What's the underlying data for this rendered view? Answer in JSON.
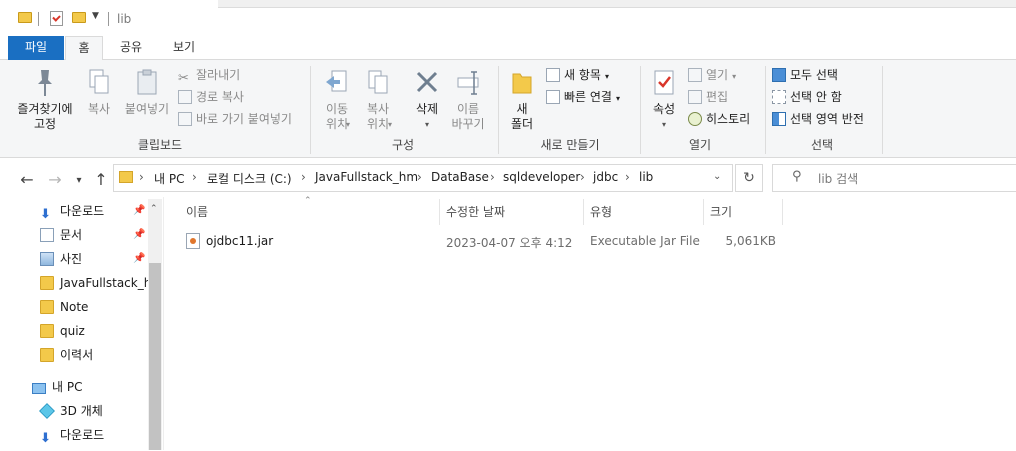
{
  "window": {
    "title": "lib"
  },
  "ribbon_tabs": [
    {
      "label": "파일"
    },
    {
      "label": "홈"
    },
    {
      "label": "공유"
    },
    {
      "label": "보기"
    }
  ],
  "clipboard": {
    "pin_quick": "즐겨찾기에\n고정",
    "copy": "복사",
    "paste": "붙여넣기",
    "cut": "잘라내기",
    "copy_path": "경로 복사",
    "paste_shortcut": "바로 가기 붙여넣기",
    "group": "클립보드"
  },
  "organize": {
    "move_to": "이동\n위치",
    "copy_to": "복사\n위치",
    "delete": "삭제",
    "rename": "이름\n바꾸기",
    "group": "구성"
  },
  "new": {
    "new_folder": "새\n폴더",
    "new_item": "새 항목",
    "easy_access": "빠른 연결",
    "group": "새로 만들기"
  },
  "open": {
    "properties": "속성",
    "open": "열기",
    "edit": "편집",
    "history": "히스토리",
    "group": "열기"
  },
  "select": {
    "select_all": "모두 선택",
    "select_none": "선택 안 함",
    "invert": "선택 영역 반전",
    "group": "선택"
  },
  "address": {
    "crumbs": [
      "내 PC",
      "로컬 디스크 (C:)",
      "JavaFullstack_hm",
      "DataBase",
      "sqldeveloper",
      "jdbc",
      "lib"
    ]
  },
  "search": {
    "placeholder": "lib 검색"
  },
  "nav": {
    "quick": [
      {
        "label": "다운로드",
        "pinned": true
      },
      {
        "label": "문서",
        "pinned": true
      },
      {
        "label": "사진",
        "pinned": true
      },
      {
        "label": "JavaFullstack_hm",
        "pinned": false
      },
      {
        "label": "Note",
        "pinned": false
      },
      {
        "label": "quiz",
        "pinned": false
      },
      {
        "label": "이력서",
        "pinned": false
      }
    ],
    "this_pc": "내 PC",
    "pc_items": [
      {
        "label": "3D 개체"
      },
      {
        "label": "다운로드"
      }
    ]
  },
  "columns": {
    "name": "이름",
    "modified": "수정한 날짜",
    "type": "유형",
    "size": "크기"
  },
  "files": [
    {
      "name": "ojdbc11.jar",
      "modified": "2023-04-07 오후 4:12",
      "type": "Executable Jar File",
      "size": "5,061KB"
    }
  ],
  "colors": {
    "accent": "#1a6fc2",
    "folder": "#f3c94a"
  }
}
